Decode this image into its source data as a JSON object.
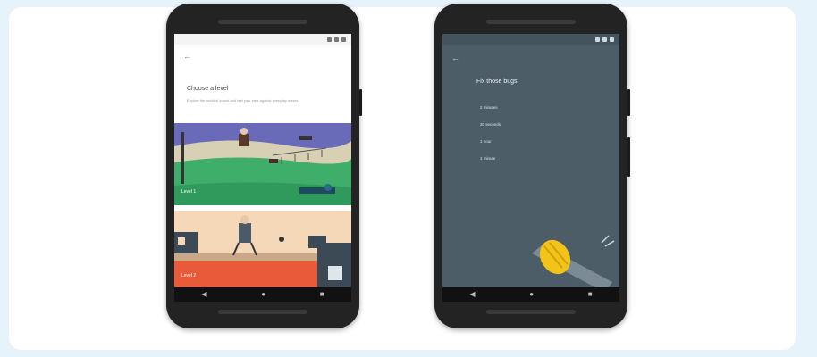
{
  "phone_left": {
    "title": "Choose a level",
    "description": "Explore the world of sound and test your ears against everyday noises.",
    "levels": [
      {
        "label": "Level 1"
      },
      {
        "label": "Level 2"
      }
    ]
  },
  "phone_right": {
    "title": "Fix those bugs!",
    "options": [
      "2 minutes",
      "30 seconds",
      "1 hour",
      "1 minute"
    ]
  },
  "colors": {
    "background": "#e6f3fb",
    "dark_screen": "#4c5d68",
    "accent_yellow": "#f2c318"
  }
}
